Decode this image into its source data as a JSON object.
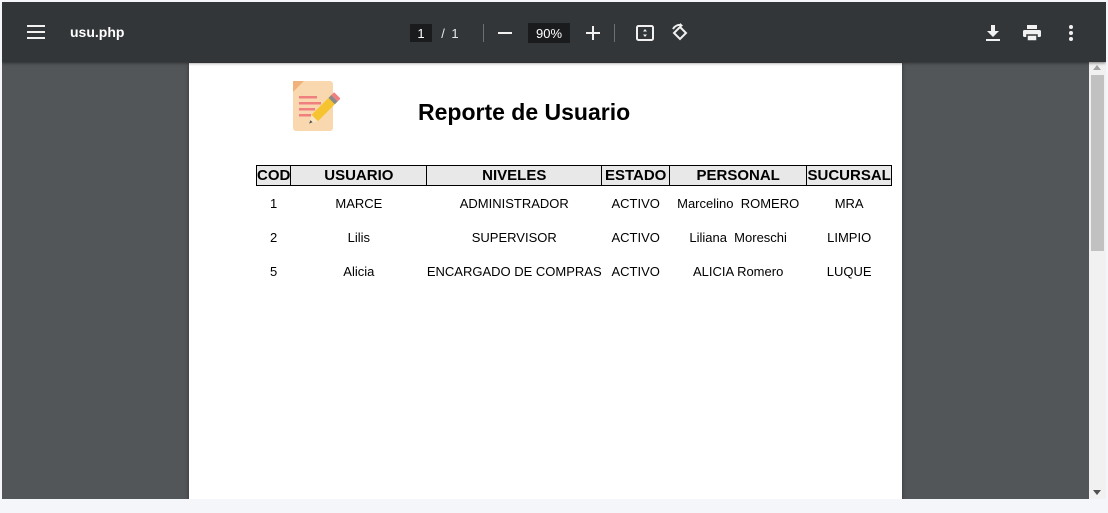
{
  "toolbar": {
    "menu_icon": "hamburger-menu-icon",
    "file_name": "usu.php",
    "current_page": "1",
    "page_separator": "/",
    "total_pages": "1",
    "zoom_level": "90%",
    "icons": [
      "minus-icon",
      "plus-icon",
      "fit-to-page-icon",
      "rotate-icon",
      "download-icon",
      "print-icon",
      "more-vert-icon"
    ]
  },
  "document": {
    "logo_icon": "notepad-pencil-icon",
    "title": "Reporte de Usuario",
    "table": {
      "headers": [
        "COD",
        "USUARIO",
        "NIVELES",
        "ESTADO",
        "PERSONAL",
        "SUCURSAL"
      ],
      "rows": [
        [
          "1",
          "MARCE",
          "ADMINISTRADOR",
          "ACTIVO",
          "Marcelino  ROMERO",
          "MRA"
        ],
        [
          "2",
          "Lilis",
          "SUPERVISOR",
          "ACTIVO",
          "Liliana  Moreschi",
          "LIMPIO"
        ],
        [
          "5",
          "Alicia",
          "ENCARGADO DE COMPRAS",
          "ACTIVO",
          "ALICIA Romero",
          "LUQUE"
        ]
      ]
    }
  },
  "colors": {
    "toolbar_bg": "#323639",
    "viewer_bg": "#525659",
    "page_bg": "#ffffff",
    "header_cell_bg": "#e8e8e8"
  }
}
